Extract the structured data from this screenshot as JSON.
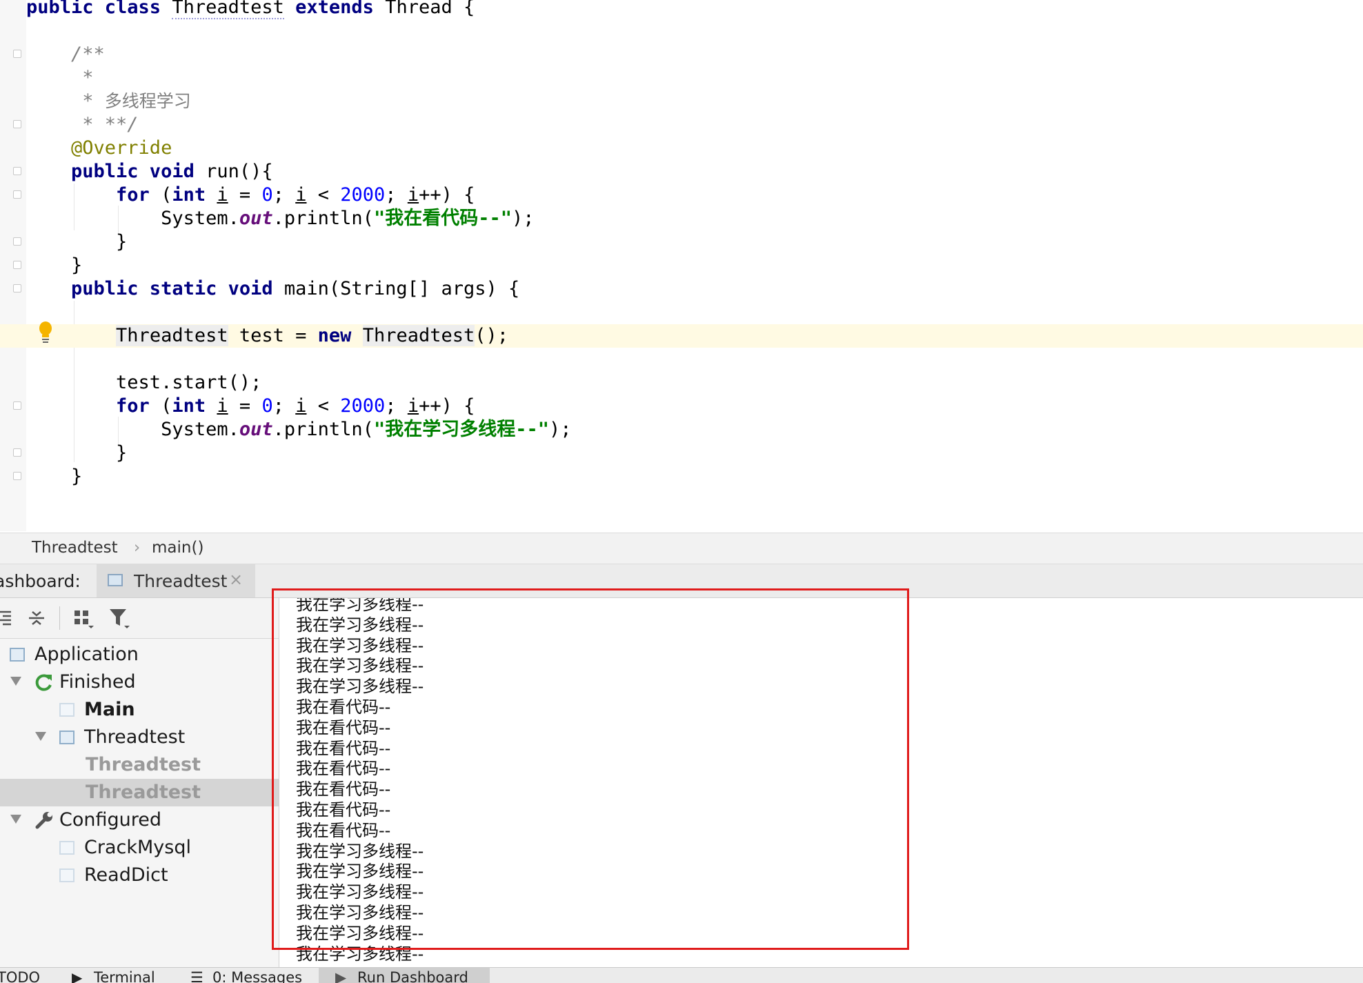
{
  "editor": {
    "lines": [
      {
        "tokens": [
          {
            "t": "public class ",
            "c": "kw"
          },
          {
            "t": "Threadtest",
            "c": "wavy"
          },
          {
            "t": " extends ",
            "c": "kw"
          },
          {
            "t": "Thread {",
            "c": ""
          }
        ]
      },
      {
        "tokens": []
      },
      {
        "tokens": [
          {
            "t": "    /**",
            "c": "cmt"
          }
        ]
      },
      {
        "tokens": [
          {
            "t": "     *",
            "c": "cmt"
          }
        ]
      },
      {
        "tokens": [
          {
            "t": "     * ",
            "c": "cmt"
          },
          {
            "t": "多线程学习",
            "c": "cmtcn"
          }
        ]
      },
      {
        "tokens": [
          {
            "t": "     * **/",
            "c": "cmt"
          }
        ]
      },
      {
        "tokens": [
          {
            "t": "    @Override",
            "c": "ann"
          }
        ]
      },
      {
        "tokens": [
          {
            "t": "    public void ",
            "c": "kw"
          },
          {
            "t": "run(){",
            "c": ""
          }
        ]
      },
      {
        "tokens": [
          {
            "t": "        ",
            "c": ""
          },
          {
            "t": "for",
            "c": "kw"
          },
          {
            "t": " (",
            "c": ""
          },
          {
            "t": "int",
            "c": "kw"
          },
          {
            "t": " ",
            "c": ""
          },
          {
            "t": "i",
            "c": "ul"
          },
          {
            "t": " = ",
            "c": ""
          },
          {
            "t": "0",
            "c": "num"
          },
          {
            "t": "; ",
            "c": ""
          },
          {
            "t": "i",
            "c": "ul"
          },
          {
            "t": " < ",
            "c": ""
          },
          {
            "t": "2000",
            "c": "num"
          },
          {
            "t": "; ",
            "c": ""
          },
          {
            "t": "i",
            "c": "ul"
          },
          {
            "t": "++) {",
            "c": ""
          }
        ]
      },
      {
        "tokens": [
          {
            "t": "            System.",
            "c": ""
          },
          {
            "t": "out",
            "c": "fld"
          },
          {
            "t": ".println(",
            "c": ""
          },
          {
            "t": "\"我在看代码--\"",
            "c": "str"
          },
          {
            "t": ");",
            "c": ""
          }
        ]
      },
      {
        "tokens": [
          {
            "t": "        }",
            "c": ""
          }
        ]
      },
      {
        "tokens": [
          {
            "t": "    }",
            "c": ""
          }
        ]
      },
      {
        "tokens": [
          {
            "t": "    public static void ",
            "c": "kw"
          },
          {
            "t": "main(String[] args) {",
            "c": ""
          }
        ]
      },
      {
        "tokens": []
      },
      {
        "tokens": [
          {
            "t": "        ",
            "c": ""
          },
          {
            "t": "Threadtest",
            "c": "ident"
          },
          {
            "t": " test = ",
            "c": ""
          },
          {
            "t": "new ",
            "c": "kw"
          },
          {
            "t": "Threadtest",
            "c": "ident"
          },
          {
            "t": "();",
            "c": ""
          }
        ],
        "highlight": true
      },
      {
        "tokens": []
      },
      {
        "tokens": [
          {
            "t": "        test.start();",
            "c": ""
          }
        ]
      },
      {
        "tokens": [
          {
            "t": "        ",
            "c": ""
          },
          {
            "t": "for",
            "c": "kw"
          },
          {
            "t": " (",
            "c": ""
          },
          {
            "t": "int",
            "c": "kw"
          },
          {
            "t": " ",
            "c": ""
          },
          {
            "t": "i",
            "c": "ul"
          },
          {
            "t": " = ",
            "c": ""
          },
          {
            "t": "0",
            "c": "num"
          },
          {
            "t": "; ",
            "c": ""
          },
          {
            "t": "i",
            "c": "ul"
          },
          {
            "t": " < ",
            "c": ""
          },
          {
            "t": "2000",
            "c": "num"
          },
          {
            "t": "; ",
            "c": ""
          },
          {
            "t": "i",
            "c": "ul"
          },
          {
            "t": "++) {",
            "c": ""
          }
        ]
      },
      {
        "tokens": [
          {
            "t": "            System.",
            "c": ""
          },
          {
            "t": "out",
            "c": "fld"
          },
          {
            "t": ".println(",
            "c": ""
          },
          {
            "t": "\"我在学习多线程--\"",
            "c": "str"
          },
          {
            "t": ");",
            "c": ""
          }
        ]
      },
      {
        "tokens": [
          {
            "t": "        }",
            "c": ""
          }
        ]
      },
      {
        "tokens": [
          {
            "t": "    }",
            "c": ""
          }
        ]
      }
    ]
  },
  "breadcrumb": {
    "class_name": "Threadtest",
    "separator": "›",
    "method": "main()"
  },
  "dashboard": {
    "label": "ashboard:",
    "tab_label": "Threadtest",
    "tab_close": "×",
    "tree": [
      {
        "label": "Application",
        "level": 0,
        "icon": "window",
        "expanded": null,
        "style": "normal"
      },
      {
        "label": "Finished",
        "level": 0,
        "icon": "rerun",
        "expanded": true,
        "style": "normal"
      },
      {
        "label": "Main",
        "level": 1,
        "icon": "window-faded",
        "expanded": null,
        "style": "bold"
      },
      {
        "label": "Threadtest",
        "level": 1,
        "icon": "window",
        "expanded": true,
        "style": "normal"
      },
      {
        "label": "Threadtest",
        "level": 2,
        "icon": "none",
        "expanded": null,
        "style": "gray"
      },
      {
        "label": "Threadtest",
        "level": 2,
        "icon": "none",
        "expanded": null,
        "style": "gray",
        "selected": true
      },
      {
        "label": "Configured",
        "level": 0,
        "icon": "wrench",
        "expanded": true,
        "style": "normal"
      },
      {
        "label": "CrackMysql",
        "level": 1,
        "icon": "window-faded",
        "expanded": null,
        "style": "normal"
      },
      {
        "label": "ReadDict",
        "level": 1,
        "icon": "window-faded",
        "expanded": null,
        "style": "normal"
      }
    ]
  },
  "console": {
    "lines": [
      "我在学习多线程--",
      "我在学习多线程--",
      "我在学习多线程--",
      "我在学习多线程--",
      "我在学习多线程--",
      "我在看代码--",
      "我在看代码--",
      "我在看代码--",
      "我在看代码--",
      "我在看代码--",
      "我在看代码--",
      "我在看代码--",
      "我在学习多线程--",
      "我在学习多线程--",
      "我在学习多线程--",
      "我在学习多线程--",
      "我在学习多线程--",
      "我在学习多线程--"
    ]
  },
  "bottom_bar": {
    "todo": "TODO",
    "terminal": "Terminal",
    "messages": "0: Messages",
    "run_dashboard": "Run Dashboard"
  },
  "colors": {
    "highlight_box": "#e01b1b",
    "current_line": "#fffae3"
  }
}
